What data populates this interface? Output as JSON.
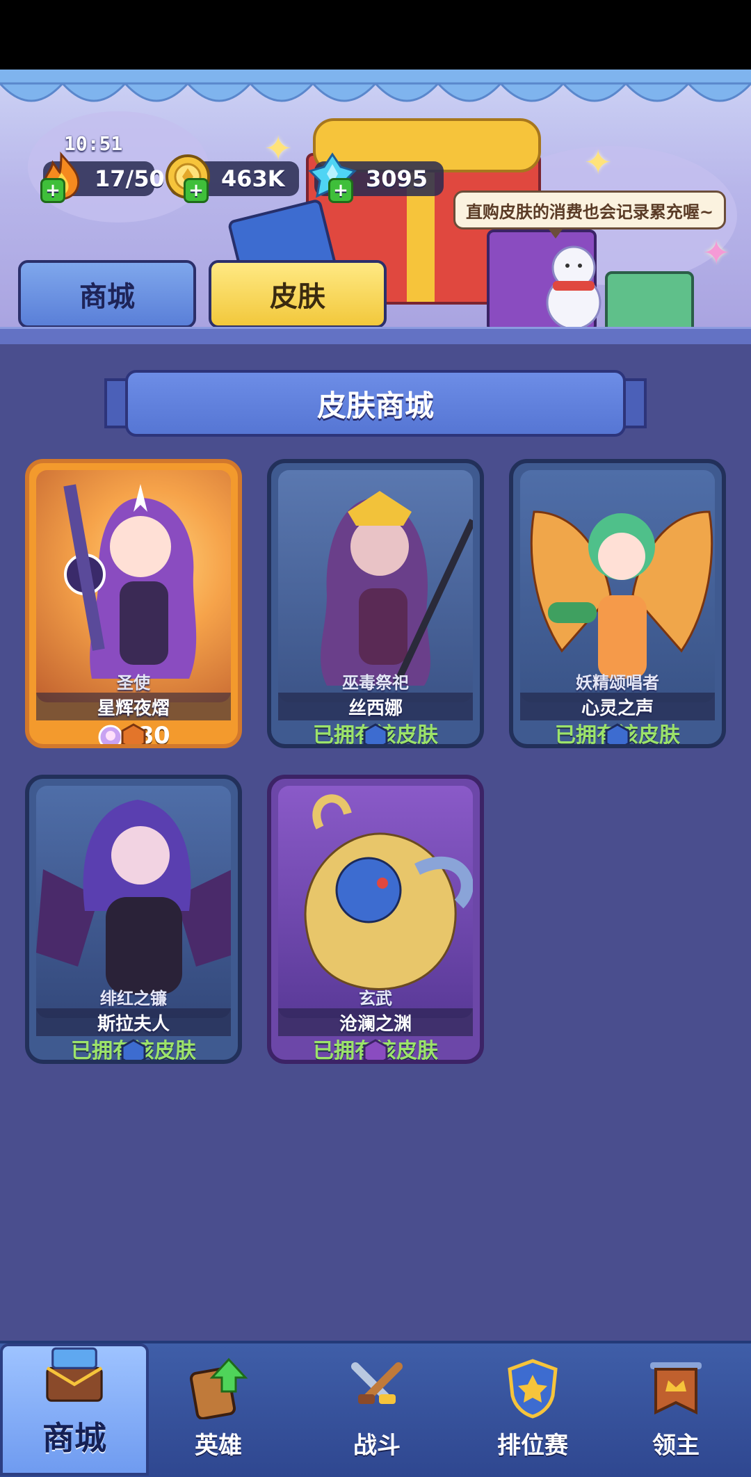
{
  "status_bar": {
    "time": "10:51"
  },
  "resources": {
    "energy": {
      "value": "17/50",
      "icon": "flame-icon"
    },
    "gold": {
      "value": "463K",
      "icon": "gold-coin-icon"
    },
    "crystal": {
      "value": "3095",
      "icon": "crystal-icon"
    }
  },
  "banner": {
    "tip": "直购皮肤的消费也会记录累充喔~"
  },
  "tabs": [
    {
      "label": "商城",
      "active": false
    },
    {
      "label": "皮肤",
      "active": true
    }
  ],
  "section": {
    "title": "皮肤商城"
  },
  "skins": [
    {
      "role": "圣使",
      "name": "星辉夜熠",
      "price": "80",
      "price_icon": "diamond-shell-icon",
      "frame": "orange"
    },
    {
      "role": "巫毒祭祀",
      "name": "丝西娜",
      "status": "已拥有该皮肤",
      "frame": "blue"
    },
    {
      "role": "妖精颂唱者",
      "name": "心灵之声",
      "status": "已拥有该皮肤",
      "frame": "blue"
    },
    {
      "role": "绯红之镰",
      "name": "斯拉夫人",
      "status": "已拥有该皮肤",
      "frame": "blue"
    },
    {
      "role": "玄武",
      "name": "沧澜之渊",
      "status": "已拥有该皮肤",
      "frame": "purple"
    }
  ],
  "nav": [
    {
      "label": "商城",
      "icon": "chest-icon",
      "active": true
    },
    {
      "label": "英雄",
      "icon": "hero-card-upgrade-icon"
    },
    {
      "label": "战斗",
      "icon": "crossed-swords-icon"
    },
    {
      "label": "排位赛",
      "icon": "rank-shield-icon"
    },
    {
      "label": "领主",
      "icon": "lord-banner-icon"
    }
  ],
  "colors": {
    "background": "#4a4e8e",
    "owned_text": "#9ce36a",
    "active_tab": "#f2c83c",
    "inactive_tab": "#5a7fd8"
  }
}
